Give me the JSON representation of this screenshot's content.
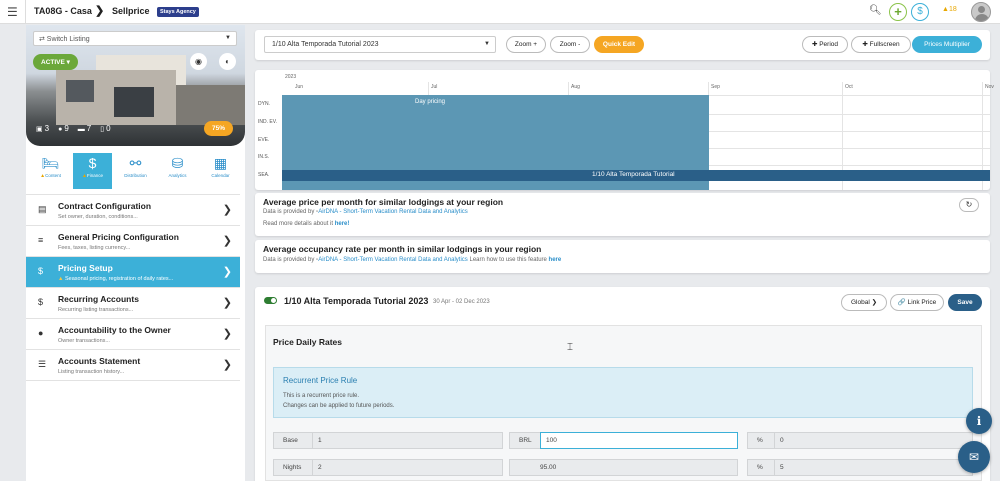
{
  "topbar": {
    "listing_code": "TA08G - Casa",
    "separator": "❯",
    "page": "Sellprice",
    "agency_badge": "Stays Agency",
    "alert_count": "18"
  },
  "sidebar": {
    "switch_listing": "⇄ Switch Listing",
    "status": "ACTIVE ▾",
    "stats": {
      "rooms": "3",
      "guests": "9",
      "beds": "7",
      "baths": "0"
    },
    "completion": "75%",
    "tabs": [
      {
        "label": "Content",
        "icon": "bed-icon",
        "warning": true
      },
      {
        "label": "Finance",
        "icon": "dollar-icon",
        "warning": true
      },
      {
        "label": "Distribution",
        "icon": "network-icon",
        "warning": false
      },
      {
        "label": "Analytics",
        "icon": "coins-icon",
        "warning": false
      },
      {
        "label": "Calendar",
        "icon": "calendar-icon",
        "warning": false
      }
    ],
    "menu": [
      {
        "title": "Contract Configuration",
        "subtitle": "Set owner, duration, conditions...",
        "icon": "document-icon",
        "warning": false
      },
      {
        "title": "General Pricing Configuration",
        "subtitle": "Fees, taxes, listing currency...",
        "icon": "sliders-icon",
        "warning": false
      },
      {
        "title": "Pricing Setup",
        "subtitle": "Seasonal pricing, registration of daily rates...",
        "icon": "dollar-icon",
        "warning": true
      },
      {
        "title": "Recurring Accounts",
        "subtitle": "Recurring listing transactions...",
        "icon": "dollar-icon",
        "warning": false
      },
      {
        "title": "Accountability to the Owner",
        "subtitle": "Owner transactions...",
        "icon": "user-icon",
        "warning": false
      },
      {
        "title": "Accounts Statement",
        "subtitle": "Listing transaction history...",
        "icon": "list-icon",
        "warning": false
      }
    ]
  },
  "toolbar": {
    "period": "1/10 Alta Temporada Tutorial 2023",
    "zoom_in": "Zoom +",
    "zoom_out": "Zoom -",
    "quick_edit": "Quick Edit",
    "add_period": "✚ Period",
    "fullscreen": "✚ Fullscreen",
    "multiplier": "Prices Multiplier"
  },
  "timeline": {
    "year": "2023",
    "months": [
      "Jun",
      "Jul",
      "Aug",
      "Sep",
      "Oct",
      "Nov"
    ],
    "rows": [
      "DYN.",
      "IND. EV.",
      "EVE.",
      "IN.S.",
      "SEA."
    ],
    "day_pricing": "Day pricing",
    "period_bar": "1/10 Alta Temporada Tutorial"
  },
  "avg_price": {
    "title": "Average price per month for similar lodgings at your region",
    "provided_prefix": "Data is provided by",
    "provider": "AirDNA - Short-Term Vacation Rental Data and Analytics",
    "more_prefix": "Read more details about it",
    "more_link": "here!"
  },
  "avg_occupancy": {
    "title": "Average occupancy rate per month in similar lodgings in your region",
    "provided_prefix": "Data is provided by",
    "provider": "AirDNA - Short-Term Vacation Rental Data and Analytics",
    "learn_prefix": "Learn how to use this feature",
    "learn_link": "here"
  },
  "rule": {
    "title": "1/10 Alta Temporada Tutorial 2023",
    "dates": "30 Apr - 02 Dec 2023",
    "global": "Global ❯",
    "link_price": "🔗 Link Price",
    "save": "Save",
    "daily_rates_title": "Price Daily Rates",
    "recurrent_title": "Recurrent Price Rule",
    "recurrent_line1": "This is a recurrent price rule.",
    "recurrent_line2": "Changes can be applied to future periods.",
    "fields": {
      "base_label": "Base",
      "base_value": "1",
      "brl_label": "BRL",
      "brl_value": "100",
      "pct1_label": "%",
      "pct1_value": "0",
      "nights_label": "Nights",
      "nights_value": "2",
      "nights_price": "95.00",
      "pct2_label": "%",
      "pct2_value": "5"
    }
  }
}
